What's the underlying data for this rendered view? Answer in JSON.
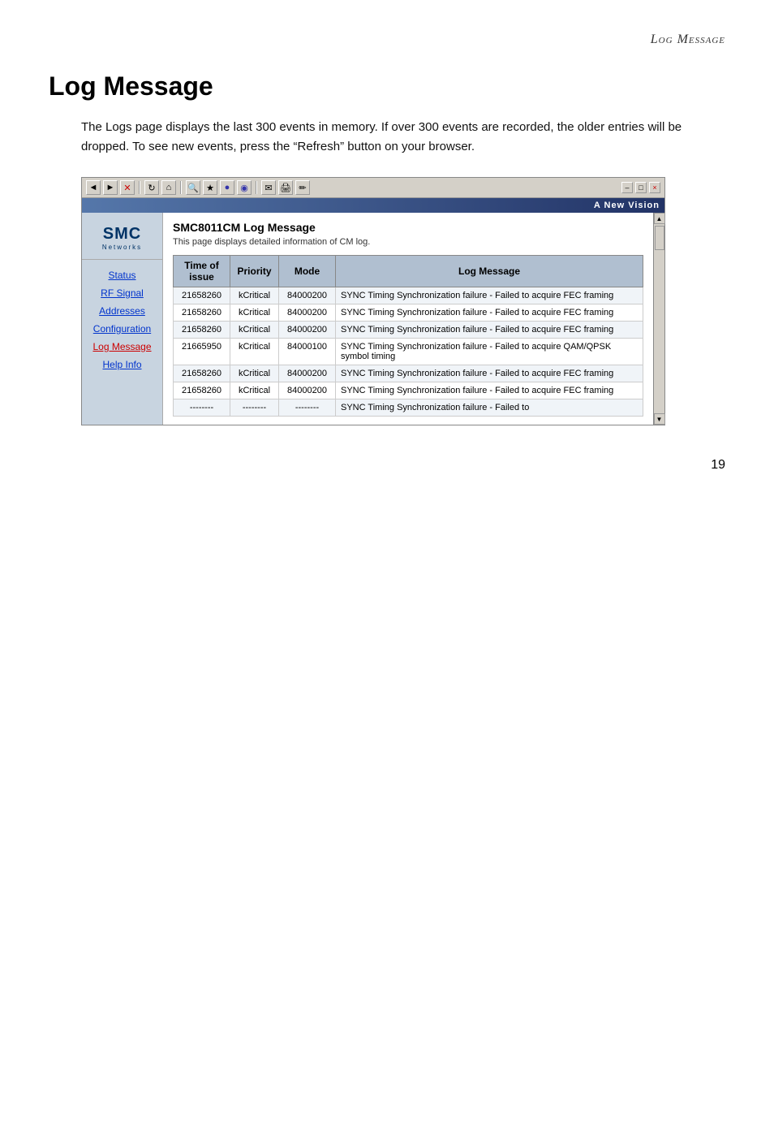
{
  "header": {
    "title": "Log Message",
    "page_title_italic": "Log Message"
  },
  "page_header_label": "Log Message",
  "main_heading": "Log Message",
  "description": "The Logs page displays the last 300 events in memory. If over 300 events are recorded, the older entries will be dropped. To see new events, press the “Refresh” button on your browser.",
  "browser": {
    "toolbar_buttons": [
      "◄",
      "►",
      "✕",
      "↺",
      "⌂",
      "✦",
      "★",
      "●",
      "◉",
      "✎",
      "⊞"
    ],
    "win_buttons": [
      "-",
      "□",
      "×"
    ],
    "vision_text": "A New Vision"
  },
  "sidebar": {
    "logo": "SMC",
    "logo_sub": "Networks",
    "nav_items": [
      {
        "label": "Status",
        "active": false
      },
      {
        "label": "RF Signal",
        "active": false
      },
      {
        "label": "Addresses",
        "active": false
      },
      {
        "label": "Configuration",
        "active": false
      },
      {
        "label": "Log Message",
        "active": true
      },
      {
        "label": "Help Info",
        "active": false
      }
    ]
  },
  "content": {
    "title": "SMC8011CM Log Message",
    "subtitle": "This page displays detailed information of CM log.",
    "table": {
      "headers": [
        "Time of issue",
        "Priority",
        "Mode",
        "Log Message"
      ],
      "rows": [
        {
          "time": "21658260",
          "priority": "kCritical",
          "mode": "84000200",
          "message": "SYNC Timing Synchronization failure - Failed to acquire FEC framing"
        },
        {
          "time": "21658260",
          "priority": "kCritical",
          "mode": "84000200",
          "message": "SYNC Timing Synchronization failure - Failed to acquire FEC framing"
        },
        {
          "time": "21658260",
          "priority": "kCritical",
          "mode": "84000200",
          "message": "SYNC Timing Synchronization failure - Failed to acquire FEC framing"
        },
        {
          "time": "21665950",
          "priority": "kCritical",
          "mode": "84000100",
          "message": "SYNC Timing Synchronization failure - Failed to acquire QAM/QPSK symbol timing"
        },
        {
          "time": "21658260",
          "priority": "kCritical",
          "mode": "84000200",
          "message": "SYNC Timing Synchronization failure - Failed to acquire FEC framing"
        },
        {
          "time": "21658260",
          "priority": "kCritical",
          "mode": "84000200",
          "message": "SYNC Timing Synchronization failure - Failed to acquire FEC framing"
        },
        {
          "time": "--------",
          "priority": "--------",
          "mode": "--------",
          "message": "SYNC Timing Synchronization failure - Failed to"
        }
      ]
    }
  },
  "page_number": "19"
}
